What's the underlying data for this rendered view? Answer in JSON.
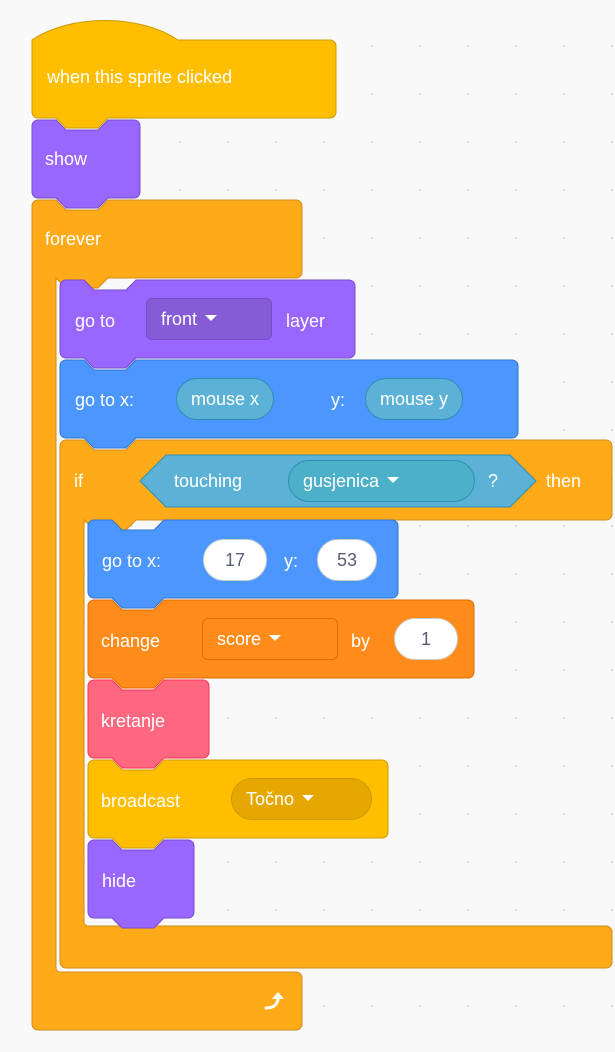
{
  "colors": {
    "events": "#ffbf00",
    "looks": "#9966ff",
    "control": "#ffab19",
    "motion": "#4c97ff",
    "sensing": "#5cb1d6",
    "variables": "#ff8c1a",
    "custom": "#ff6680",
    "canvas": "#f9f9f9"
  },
  "script": {
    "hat": {
      "label": "when this sprite clicked"
    },
    "show": {
      "label": "show"
    },
    "forever": {
      "label": "forever",
      "loop_icon": "loop-arrow-icon"
    },
    "go_to_layer": {
      "prefix": "go to",
      "menu": "front",
      "suffix": "layer"
    },
    "go_to_mouse": {
      "prefix": "go to x:",
      "x_reporter": "mouse x",
      "y_label": "y:",
      "y_reporter": "mouse y"
    },
    "if_block": {
      "label": "if",
      "condition": {
        "prefix": "touching",
        "menu": "gusjenica",
        "suffix": "?"
      },
      "then_label": "then"
    },
    "go_to_xy": {
      "prefix": "go to x:",
      "x_value": "17",
      "y_label": "y:",
      "y_value": "53"
    },
    "change_var": {
      "prefix": "change",
      "menu": "score",
      "by_label": "by",
      "value": "1"
    },
    "custom_block": {
      "label": "kretanje"
    },
    "broadcast": {
      "prefix": "broadcast",
      "menu": "Točno"
    },
    "hide": {
      "label": "hide"
    }
  }
}
